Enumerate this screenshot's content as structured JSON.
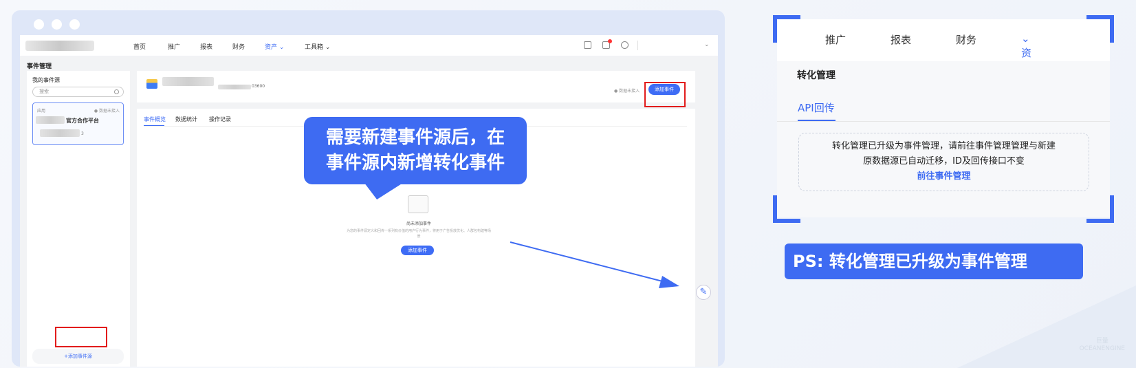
{
  "browser": {
    "topnav": {
      "items": [
        "首页",
        "推广",
        "报表",
        "财务",
        "资产",
        "工具箱"
      ],
      "active": "资产"
    },
    "page_title": "事件管理",
    "left_panel": {
      "title": "我的事件源",
      "search_placeholder": "搜索",
      "card": {
        "type": "应用",
        "status": "● 数据未接入",
        "name_suffix": "官方合作平台",
        "id_suffix": "3"
      },
      "add_source_label": "+添加事件源"
    },
    "main_top": {
      "id_suffix": "03600",
      "status": "● 数据未接入",
      "add_event_label": "添加事件"
    },
    "tabs": [
      "事件概览",
      "数据统计",
      "操作记录"
    ],
    "active_tab": "事件概览",
    "empty_state": {
      "title": "尚未添加事件",
      "description": "为您的事件源定义和回传一系列有价值的用户行为事件，将用于广告投放优化、人群包构建等场景",
      "button_label": "添加事件"
    }
  },
  "callout": {
    "line1": "需要新建事件源后，在",
    "line2": "事件源内新增转化事件"
  },
  "right_panel": {
    "nav": [
      "推广",
      "报表",
      "财务",
      "资产"
    ],
    "active_nav": "资产",
    "section_title": "转化管理",
    "tab": "API回传",
    "notice_line1": "转化管理已升级为事件管理，请前往事件管理管理与新建",
    "notice_line2": "原数据源已自动迁移，ID及回传接口不变",
    "notice_link": "前往事件管理"
  },
  "ps_banner": "PS: 转化管理已升级为事件管理",
  "colors": {
    "accent": "#3e6bf2",
    "highlight": "#e21b1b",
    "background": "#f2f3f5"
  }
}
